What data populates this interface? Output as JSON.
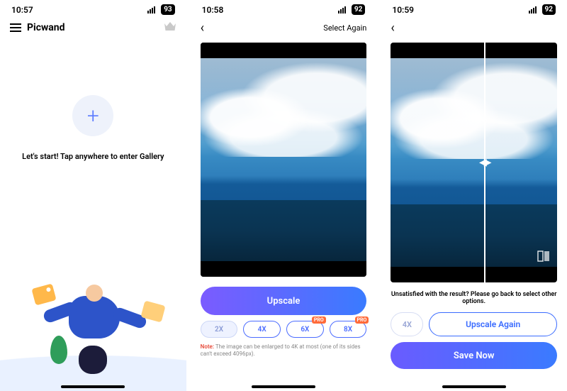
{
  "screen1": {
    "status": {
      "time": "10:57",
      "battery": "93"
    },
    "app_title": "Picwand",
    "caption": "Let's start! Tap anywhere to enter Gallery"
  },
  "screen2": {
    "status": {
      "time": "10:58",
      "battery": "92"
    },
    "header_link": "Select Again",
    "primary_button": "Upscale",
    "scales": [
      {
        "label": "2X",
        "pro": false,
        "active": true
      },
      {
        "label": "4X",
        "pro": false,
        "active": false
      },
      {
        "label": "6X",
        "pro": true,
        "active": false
      },
      {
        "label": "8X",
        "pro": true,
        "active": false
      }
    ],
    "pro_tag": "PRO",
    "note_prefix": "Note:",
    "note_text": " The image can be enlarged to 4K at most (one of its sides can't exceed 4096px)."
  },
  "screen3": {
    "status": {
      "time": "10:59",
      "battery": "92"
    },
    "caption": "Unsatisfied with the result? Please go back to select other options.",
    "static_scale": "4X",
    "upscale_again": "Upscale Again",
    "save_now": "Save Now"
  }
}
